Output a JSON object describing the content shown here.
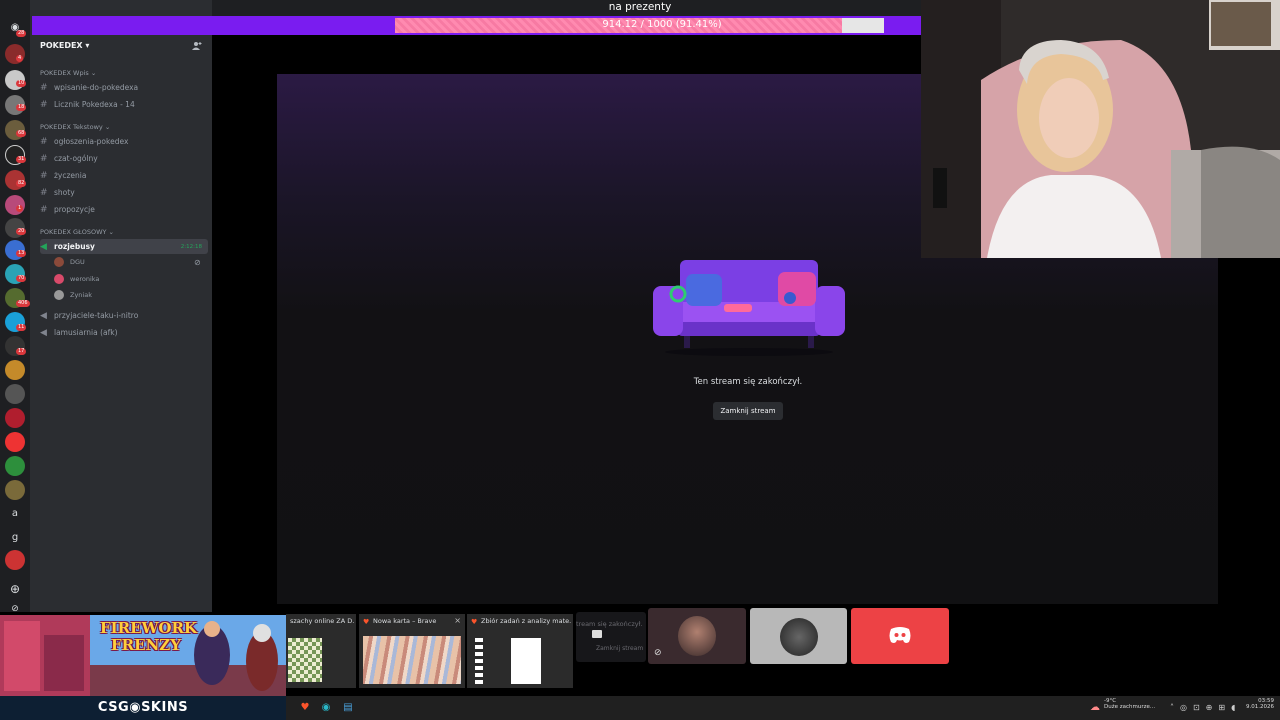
{
  "stream_overlay": {
    "goal_label": "na prezenty",
    "goal_progress_text": "914.12 / 1000 (91.41%)",
    "goal_fraction": 0.9141
  },
  "server": {
    "name": "POKEDEX",
    "categories": [
      {
        "name": "POKEDEX Wpis",
        "channels": [
          {
            "name": "wpisanie-do-pokedexa"
          },
          {
            "name": "Licznik Pokedexa - 14"
          }
        ]
      },
      {
        "name": "POKEDEX Tekstowy",
        "channels": [
          {
            "name": "ogłoszenia-pokedex"
          },
          {
            "name": "czat-ogólny"
          },
          {
            "name": "życzenia"
          },
          {
            "name": "shoty"
          },
          {
            "name": "propozycje"
          }
        ]
      },
      {
        "name": "POKEDEX GŁOSOWY"
      }
    ],
    "voice_active": {
      "name": "rozjebusy",
      "timer": "2:12:18",
      "users": [
        {
          "name": "DGU"
        },
        {
          "name": "weronika"
        },
        {
          "name": "Zyniak"
        }
      ]
    },
    "voice_other": [
      {
        "name": "przyjaciele-taku-i-nitro"
      },
      {
        "name": "lamusiarnia (afk)"
      }
    ]
  },
  "rail_badges": [
    "28",
    "4",
    "10",
    "18",
    "68",
    "31",
    "82",
    "1",
    "20",
    "13",
    "70",
    "406",
    "11",
    "17",
    "a",
    "g"
  ],
  "stream_ended": {
    "message": "Ten stream się zakończył.",
    "close_label": "Zamknij stream"
  },
  "game_banner": {
    "title_line1": "FIREWORK",
    "title_line2": "FRENZY",
    "sponsor": "CSG◉SKINS"
  },
  "taskbar_thumbs": [
    {
      "title": "szachy online ZA D..."
    },
    {
      "title": "Nowa karta – Brave"
    },
    {
      "title": "Zbiór zadań z analizy mate..."
    }
  ],
  "mini_tile_text": "tream się zakończył.",
  "mini_tile_sub": "Zamknij stream",
  "tray": {
    "weather_temp": "-9°C",
    "weather_desc": "Duże zachmurze...",
    "time": "03:59",
    "date": "9.01.2026"
  },
  "colors": {
    "goal_bar": "#7a1cf0",
    "goal_fill": "#ff8ab0",
    "discord_red": "#ed4245",
    "accent_green": "#23a55a"
  }
}
